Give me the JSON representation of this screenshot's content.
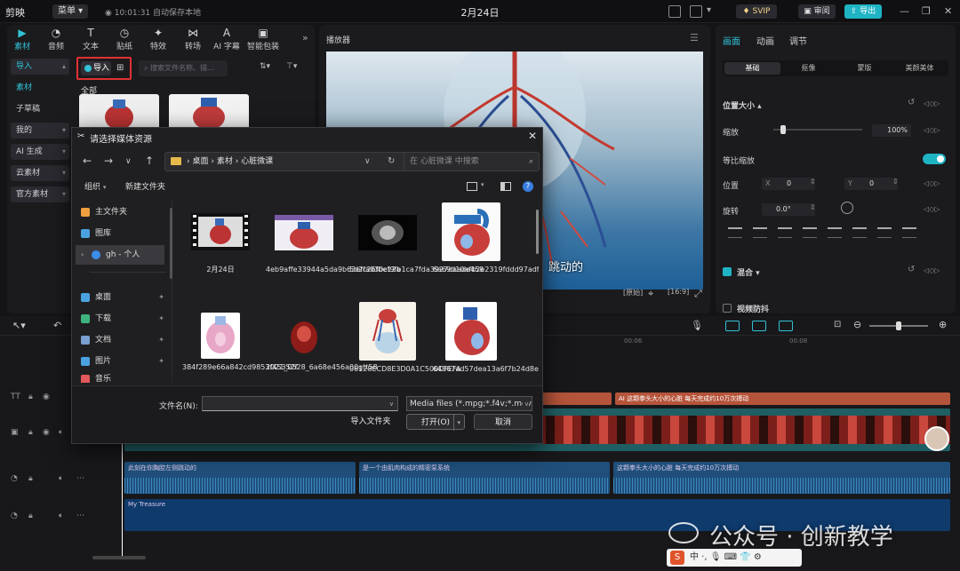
{
  "app": {
    "logo": "剪映",
    "menu": "菜单",
    "save_status": "10:01:31 自动保存本地",
    "title": "2月24日",
    "svip": "SVIP",
    "review": "审阅",
    "export": "导出"
  },
  "toolbar_tabs": [
    {
      "label": "素材",
      "icon": "media-icon"
    },
    {
      "label": "音频",
      "icon": "audio-icon"
    },
    {
      "label": "文本",
      "icon": "text-icon"
    },
    {
      "label": "贴纸",
      "icon": "sticker-icon"
    },
    {
      "label": "特效",
      "icon": "effects-icon"
    },
    {
      "label": "转场",
      "icon": "transition-icon"
    },
    {
      "label": "AI 字幕",
      "icon": "ai-caption-icon"
    },
    {
      "label": "智能包装",
      "icon": "smart-pack-icon"
    }
  ],
  "left_nav": [
    "导入",
    "素材",
    "子草稿",
    "我的",
    "AI 生成",
    "云素材",
    "官方素材"
  ],
  "media": {
    "import_label": "导入",
    "search_placeholder": "搜索文件名称、描...",
    "all_label": "全部"
  },
  "player": {
    "label": "播放器",
    "subtitle": "跳动的",
    "ratio": "16:9",
    "fit": "原始"
  },
  "inspector": {
    "tabs": [
      "画面",
      "动画",
      "调节"
    ],
    "subtabs": [
      "基础",
      "抠像",
      "蒙版",
      "美颜美体"
    ],
    "section_pos": "位置大小",
    "scale_label": "缩放",
    "scale_value": "100%",
    "uniform_label": "等比缩放",
    "position_label": "位置",
    "x_label": "X",
    "x_value": "0",
    "y_label": "Y",
    "y_value": "0",
    "rotate_label": "旋转",
    "rotate_value": "0.0°",
    "blend_label": "混合",
    "stabilize_label": "视频防抖",
    "uniform_on": true,
    "scale_fraction": 0.1
  },
  "timeline": {
    "ruler": [
      "00:06",
      "00:08"
    ],
    "text_clips": [
      "AI 这颗拳头大小的心脏 每天完成约10万次搏动"
    ],
    "audio_clips": [
      "此刻在你胸腔左侧跳动的",
      "是一个由肌肉构成的精密泵系统",
      "这颗拳头大小的心脏 每天完成约10万次搏动"
    ],
    "music": "My Treasure"
  },
  "dialog": {
    "title": "请选择媒体资源",
    "path": [
      "桌面",
      "素材",
      "心脏微课"
    ],
    "search_placeholder": "在 心脏微课 中搜索",
    "organize": "组织",
    "new_folder": "新建文件夹",
    "nav": [
      {
        "label": "主文件夹",
        "icon": "home-icon",
        "color": "#f0a040"
      },
      {
        "label": "图库",
        "icon": "gallery-icon",
        "color": "#4aa3e0"
      },
      {
        "label": "gh - 个人",
        "icon": "cloud-icon",
        "color": "#3b8ee8"
      },
      {
        "label": "桌面",
        "icon": "desktop-icon",
        "color": "#4aa3e0"
      },
      {
        "label": "下载",
        "icon": "download-icon",
        "color": "#3fb27f"
      },
      {
        "label": "文档",
        "icon": "documents-icon",
        "color": "#7a9fd0"
      },
      {
        "label": "图片",
        "icon": "pictures-icon",
        "color": "#4aa3e0"
      },
      {
        "label": "音乐",
        "icon": "music-icon",
        "color": "#e2585b"
      }
    ],
    "files": [
      {
        "name": "2月24日",
        "kind": "video"
      },
      {
        "name": "4eb9affe33944a5da9b63efc26fbe12a",
        "kind": "heart-banner"
      },
      {
        "name": "5d2fa030cf9fb1ca7fda3927daade458",
        "kind": "xray"
      },
      {
        "name": "6a69d10afb2e2319fddd97adf342a4c2",
        "kind": "heart-diagram"
      },
      {
        "name": "384f289e66a842cd9853f45352f",
        "kind": "heart-pink"
      },
      {
        "name": "2021_0528_6a68e456a00gtt58",
        "kind": "heart-real"
      },
      {
        "name": "06128ECD8E3D0A1C500DFEFA",
        "kind": "circulation"
      },
      {
        "name": "64367ad57dea13a6f7b24d8e62",
        "kind": "heart-chart"
      }
    ],
    "filename_label": "文件名(N):",
    "filename_value": "",
    "filetype": "Media files (*.mpg;*.f4v;*.mov",
    "import_folder": "导入文件夹",
    "open": "打开(O)",
    "cancel": "取消"
  },
  "watermark": "公众号 · 创新教学",
  "ime": "中 ·, 🎙 ⌨ 👕 ⚙"
}
